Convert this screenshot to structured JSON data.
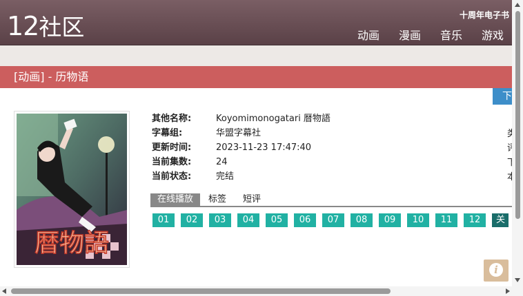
{
  "header": {
    "logo_num": "12",
    "logo_text": "社区",
    "ebook_link": "十周年电子书",
    "nav": [
      "动画",
      "漫画",
      "音乐",
      "游戏"
    ]
  },
  "page": {
    "title": "[动画] - 历物语",
    "download_label": "下"
  },
  "details": [
    {
      "label": "其他名称:",
      "value": "Koyomimonogatari 暦物語"
    },
    {
      "label": "字幕组:",
      "value": "华盟字幕社"
    },
    {
      "label": "更新时间:",
      "value": "2023-11-23 17:47:40"
    },
    {
      "label": "当前集数:",
      "value": "24"
    },
    {
      "label": "当前状态:",
      "value": "完结"
    }
  ],
  "right_labels": [
    "类",
    "评",
    "下",
    "本"
  ],
  "tabs": [
    {
      "label": "在线播放",
      "active": true
    },
    {
      "label": "标签",
      "active": false
    },
    {
      "label": "短评",
      "active": false
    }
  ],
  "episodes": [
    "01",
    "02",
    "03",
    "04",
    "05",
    "06",
    "07",
    "08",
    "09",
    "10",
    "11",
    "12"
  ],
  "episodes_more": "关",
  "poster": {
    "title_text": "暦物語"
  },
  "colors": {
    "header": "#6b5056",
    "title_bar": "#cc5e5e",
    "episode": "#21b1a3",
    "download": "#3d8ec9"
  },
  "icons": {
    "info": "info-icon"
  },
  "info_glyph": "i"
}
